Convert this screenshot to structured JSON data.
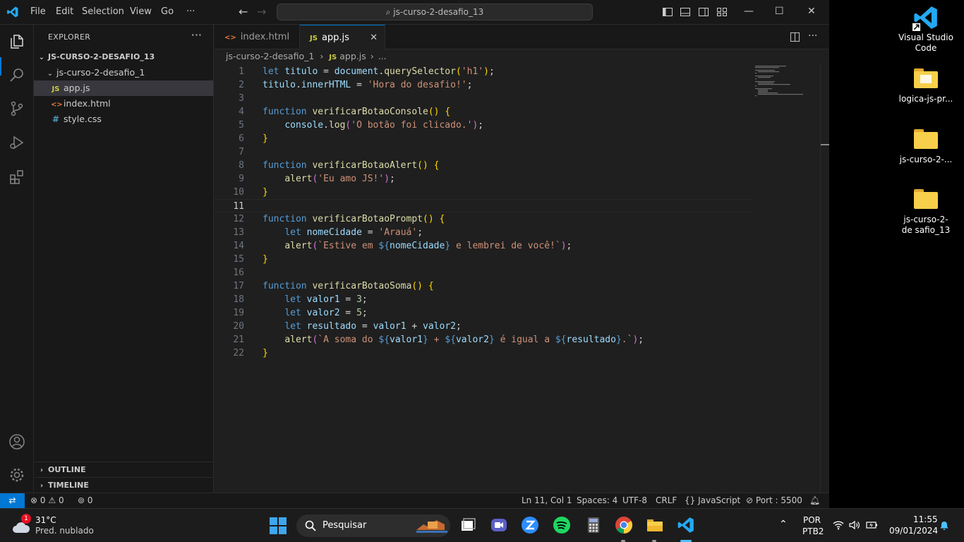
{
  "window": {
    "menu": [
      "File",
      "Edit",
      "Selection",
      "View",
      "Go"
    ],
    "more": "···",
    "search_text": "js-curso-2-desafio_13"
  },
  "explorer": {
    "title": "EXPLORER",
    "more": "···",
    "root": "JS-CURSO-2-DESAFIO_13",
    "folder": "js-curso-2-desafio_1",
    "files": [
      {
        "name": "app.js",
        "badge": "JS",
        "badge_color": "#cbcb41",
        "selected": true
      },
      {
        "name": "index.html",
        "badge": "<>",
        "badge_color": "#e37933",
        "selected": false
      },
      {
        "name": "style.css",
        "badge": "#",
        "badge_color": "#519aba",
        "selected": false
      }
    ],
    "outline": "OUTLINE",
    "timeline": "TIMELINE"
  },
  "tabs": [
    {
      "label": "index.html",
      "badge": "<>",
      "active": false
    },
    {
      "label": "app.js",
      "badge": "JS",
      "active": true,
      "close": "✕"
    }
  ],
  "breadcrumb": {
    "folder": "js-curso-2-desafio_1",
    "file": "app.js",
    "tail": "..."
  },
  "code": {
    "current_line": 11,
    "lines": [
      [
        [
          "k",
          "let "
        ],
        [
          "v",
          "titulo"
        ],
        [
          "o",
          " = "
        ],
        [
          "v",
          "document"
        ],
        [
          "o",
          "."
        ],
        [
          "f",
          "querySelector"
        ],
        [
          "p1",
          "("
        ],
        [
          "s",
          "'h1'"
        ],
        [
          "p1",
          ")"
        ],
        [
          "o",
          ";"
        ]
      ],
      [
        [
          "v",
          "titulo"
        ],
        [
          "o",
          "."
        ],
        [
          "v",
          "innerHTML"
        ],
        [
          "o",
          " = "
        ],
        [
          "s",
          "'Hora do desafio!'"
        ],
        [
          "o",
          ";"
        ]
      ],
      [],
      [
        [
          "k",
          "function "
        ],
        [
          "f",
          "verificarBotaoConsole"
        ],
        [
          "p1",
          "()"
        ],
        [
          "o",
          " "
        ],
        [
          "p1",
          "{"
        ]
      ],
      [
        [
          "o",
          "    "
        ],
        [
          "v",
          "console"
        ],
        [
          "o",
          "."
        ],
        [
          "f",
          "log"
        ],
        [
          "p2",
          "("
        ],
        [
          "s",
          "'O botão foi clicado.'"
        ],
        [
          "p2",
          ")"
        ],
        [
          "o",
          ";"
        ]
      ],
      [
        [
          "p1",
          "}"
        ]
      ],
      [],
      [
        [
          "k",
          "function "
        ],
        [
          "f",
          "verificarBotaoAlert"
        ],
        [
          "p1",
          "()"
        ],
        [
          "o",
          " "
        ],
        [
          "p1",
          "{"
        ]
      ],
      [
        [
          "o",
          "    "
        ],
        [
          "f",
          "alert"
        ],
        [
          "p2",
          "("
        ],
        [
          "s",
          "'Eu amo JS!'"
        ],
        [
          "p2",
          ")"
        ],
        [
          "o",
          ";"
        ]
      ],
      [
        [
          "p1",
          "}"
        ]
      ],
      [],
      [
        [
          "k",
          "function "
        ],
        [
          "f",
          "verificarBotaoPrompt"
        ],
        [
          "p1",
          "()"
        ],
        [
          "o",
          " "
        ],
        [
          "p1",
          "{"
        ]
      ],
      [
        [
          "o",
          "    "
        ],
        [
          "k",
          "let "
        ],
        [
          "v",
          "nomeCidade"
        ],
        [
          "o",
          " = "
        ],
        [
          "s",
          "'Arauá'"
        ],
        [
          "o",
          ";"
        ]
      ],
      [
        [
          "o",
          "    "
        ],
        [
          "f",
          "alert"
        ],
        [
          "p2",
          "("
        ],
        [
          "s",
          "`Estive em "
        ],
        [
          "k",
          "${"
        ],
        [
          "v",
          "nomeCidade"
        ],
        [
          "k",
          "}"
        ],
        [
          "s",
          " e lembrei de você!`"
        ],
        [
          "p2",
          ")"
        ],
        [
          "o",
          ";"
        ]
      ],
      [
        [
          "p1",
          "}"
        ]
      ],
      [],
      [
        [
          "k",
          "function "
        ],
        [
          "f",
          "verificarBotaoSoma"
        ],
        [
          "p1",
          "()"
        ],
        [
          "o",
          " "
        ],
        [
          "p1",
          "{"
        ]
      ],
      [
        [
          "o",
          "    "
        ],
        [
          "k",
          "let "
        ],
        [
          "v",
          "valor1"
        ],
        [
          "o",
          " = "
        ],
        [
          "n",
          "3"
        ],
        [
          "o",
          ";"
        ]
      ],
      [
        [
          "o",
          "    "
        ],
        [
          "k",
          "let "
        ],
        [
          "v",
          "valor2"
        ],
        [
          "o",
          " = "
        ],
        [
          "n",
          "5"
        ],
        [
          "o",
          ";"
        ]
      ],
      [
        [
          "o",
          "    "
        ],
        [
          "k",
          "let "
        ],
        [
          "v",
          "resultado"
        ],
        [
          "o",
          " = "
        ],
        [
          "v",
          "valor1"
        ],
        [
          "o",
          " + "
        ],
        [
          "v",
          "valor2"
        ],
        [
          "o",
          ";"
        ]
      ],
      [
        [
          "o",
          "    "
        ],
        [
          "f",
          "alert"
        ],
        [
          "p2",
          "("
        ],
        [
          "s",
          "`A soma do "
        ],
        [
          "k",
          "${"
        ],
        [
          "v",
          "valor1"
        ],
        [
          "k",
          "}"
        ],
        [
          "s",
          " + "
        ],
        [
          "k",
          "${"
        ],
        [
          "v",
          "valor2"
        ],
        [
          "k",
          "}"
        ],
        [
          "s",
          " é igual a "
        ],
        [
          "k",
          "${"
        ],
        [
          "v",
          "resultado"
        ],
        [
          "k",
          "}"
        ],
        [
          "s",
          ".`"
        ],
        [
          "p2",
          ")"
        ],
        [
          "o",
          ";"
        ]
      ],
      [
        [
          "p1",
          "}"
        ]
      ]
    ]
  },
  "status": {
    "errors": "0",
    "warnings": "0",
    "ports": "0",
    "position": "Ln 11, Col 1",
    "spaces": "Spaces: 4",
    "encoding": "UTF-8",
    "eol": "CRLF",
    "language": "JavaScript",
    "port": "Port : 5500"
  },
  "desktop": [
    {
      "label": "Visual Studio Code",
      "icon": "vscode-icon"
    },
    {
      "label": "logica-js-pr...",
      "icon": "folder-icon"
    },
    {
      "label": "js-curso-2-...",
      "icon": "folder-icon"
    },
    {
      "label": "js-curso-2-de safio_13",
      "icon": "folder-icon"
    }
  ],
  "taskbar": {
    "weather_badge": "1",
    "temperature": "31°C",
    "weather_desc": "Pred. nublado",
    "search": "Pesquisar",
    "lang1": "POR",
    "lang2": "PTB2",
    "time": "11:55",
    "date": "09/01/2024"
  }
}
